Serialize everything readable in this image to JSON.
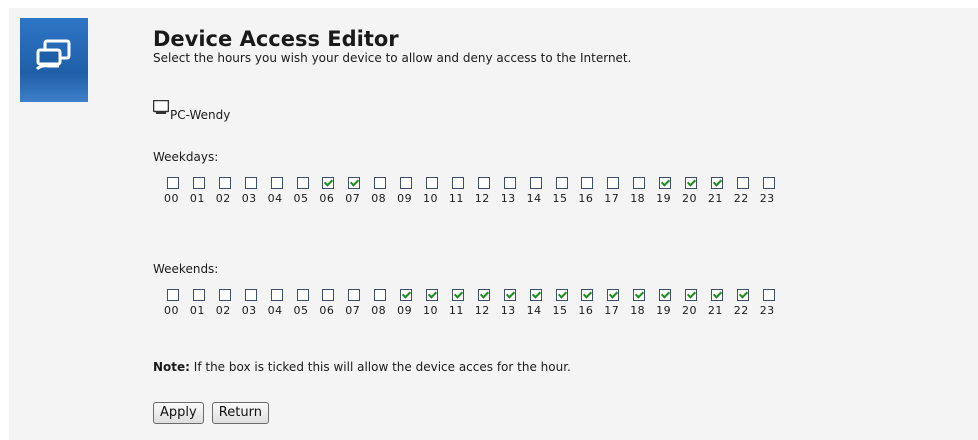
{
  "page": {
    "title": "Device Access Editor",
    "subtitle": "Select the hours you wish your device to allow and deny access to the Internet."
  },
  "device": {
    "name": "PC-Wendy",
    "icon": "monitor-icon"
  },
  "weekdays": {
    "label": "Weekdays:",
    "hours": [
      "00",
      "01",
      "02",
      "03",
      "04",
      "05",
      "06",
      "07",
      "08",
      "09",
      "10",
      "11",
      "12",
      "13",
      "14",
      "15",
      "16",
      "17",
      "18",
      "19",
      "20",
      "21",
      "22",
      "23"
    ],
    "checked": [
      false,
      false,
      false,
      false,
      false,
      false,
      true,
      true,
      false,
      false,
      false,
      false,
      false,
      false,
      false,
      false,
      false,
      false,
      false,
      true,
      true,
      true,
      false,
      false
    ]
  },
  "weekends": {
    "label": "Weekends:",
    "hours": [
      "00",
      "01",
      "02",
      "03",
      "04",
      "05",
      "06",
      "07",
      "08",
      "09",
      "10",
      "11",
      "12",
      "13",
      "14",
      "15",
      "16",
      "17",
      "18",
      "19",
      "20",
      "21",
      "22",
      "23"
    ],
    "checked": [
      false,
      false,
      false,
      false,
      false,
      false,
      false,
      false,
      false,
      true,
      true,
      true,
      true,
      true,
      true,
      true,
      true,
      true,
      true,
      true,
      true,
      true,
      true,
      false
    ]
  },
  "note": {
    "bold": "Note:",
    "text": " If the box is ticked this will allow the device acces for the hour."
  },
  "buttons": {
    "apply": "Apply",
    "return": "Return"
  },
  "colors": {
    "side_icon_bg": "#1f5fa8",
    "check_mark": "#1e8c1e"
  }
}
